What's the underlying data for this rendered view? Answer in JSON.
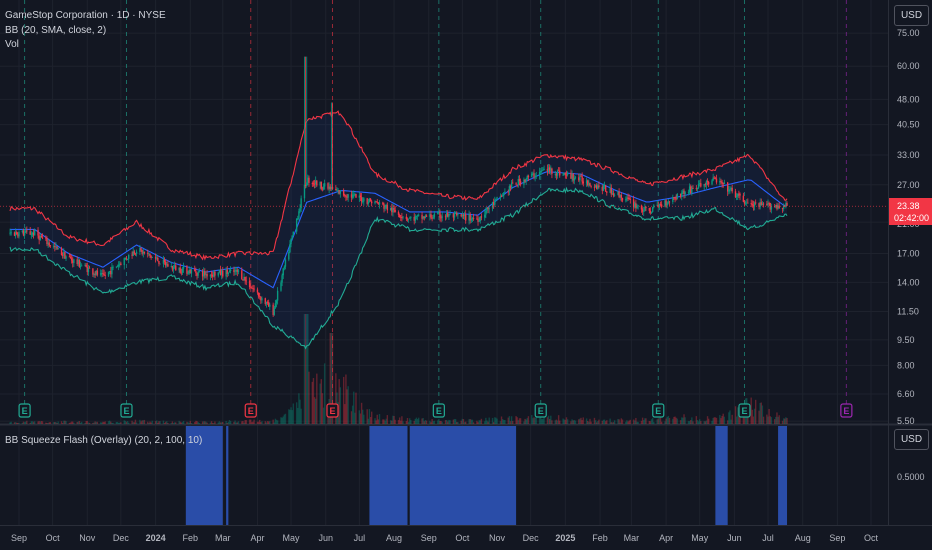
{
  "legend": {
    "symbol": "GameStop Corporation · 1D · NYSE",
    "bb": "BB (20, SMA, close, 2)",
    "vol": "Vol",
    "squeeze": "BB Squeeze Flash (Overlay) (20, 2, 100, 10)"
  },
  "currency_button": "USD",
  "colors": {
    "background": "#131722",
    "upper_band": "#f23645",
    "lower_band": "#22ab94",
    "basis": "#2962ff",
    "candle_up": "#089981",
    "candle_down": "#f23645",
    "squeeze": "#2a4da8",
    "earnings_past_up": "#22ab94",
    "earnings_past_down": "#f23645",
    "earnings_future": "#9c27b0"
  },
  "price_label": {
    "value": "23.38",
    "countdown": "02:42:00"
  },
  "chart_data": [
    {
      "type": "candlestick",
      "scale": "log",
      "y_ticks": [
        "75.00",
        "60.00",
        "48.00",
        "40.50",
        "33.00",
        "27.00",
        "21.00",
        "17.00",
        "14.00",
        "11.50",
        "9.50",
        "8.00",
        "6.60",
        "5.50"
      ],
      "ylim": [
        5.5,
        80
      ],
      "x_ticks": [
        "Sep",
        "Oct",
        "Nov",
        "Dec",
        "2024",
        "Feb",
        "Mar",
        "Apr",
        "May",
        "Jun",
        "Jul",
        "Aug",
        "Sep",
        "Oct",
        "Nov",
        "Dec",
        "2025",
        "Feb",
        "Mar",
        "Apr",
        "May",
        "Jun",
        "Jul",
        "Aug",
        "Sep",
        "Oct"
      ],
      "series": [
        {
          "name": "Close",
          "x": [
            "2023-09",
            "2023-10",
            "2023-11",
            "2023-12",
            "2024-01",
            "2024-02",
            "2024-03",
            "2024-04",
            "2024-05",
            "2024-06",
            "2024-07",
            "2024-08",
            "2024-09",
            "2024-10",
            "2024-11",
            "2024-12",
            "2025-01",
            "2025-02",
            "2025-03",
            "2025-04",
            "2025-05",
            "2025-06",
            "2025-07"
          ],
          "values": [
            19.5,
            16.5,
            14.5,
            17.5,
            15.5,
            14.8,
            15.0,
            11.5,
            28.0,
            25.5,
            24.0,
            21.5,
            22.0,
            21.5,
            27.0,
            30.0,
            28.0,
            25.5,
            22.5,
            25.5,
            28.0,
            23.5,
            23.38
          ]
        },
        {
          "name": "BB Upper",
          "x": [
            "2023-09",
            "2023-10",
            "2023-11",
            "2023-12",
            "2024-01",
            "2024-02",
            "2024-03",
            "2024-04",
            "2024-05",
            "2024-06",
            "2024-07",
            "2024-08",
            "2024-09",
            "2024-10",
            "2024-11",
            "2024-12",
            "2025-01",
            "2025-02",
            "2025-03",
            "2025-04",
            "2025-05",
            "2025-06",
            "2025-07"
          ],
          "values": [
            23.0,
            19.0,
            18.0,
            21.0,
            17.5,
            16.5,
            17.0,
            17.0,
            42.0,
            44.0,
            29.0,
            26.0,
            25.0,
            24.5,
            30.0,
            33.0,
            32.0,
            29.5,
            27.0,
            28.5,
            30.0,
            33.0,
            24.5
          ]
        },
        {
          "name": "BB Basis",
          "x": [
            "2023-09",
            "2023-10",
            "2023-11",
            "2023-12",
            "2024-01",
            "2024-02",
            "2024-03",
            "2024-04",
            "2024-05",
            "2024-06",
            "2024-07",
            "2024-08",
            "2024-09",
            "2024-10",
            "2024-11",
            "2024-12",
            "2025-01",
            "2025-02",
            "2025-03",
            "2025-04",
            "2025-05",
            "2025-06",
            "2025-07"
          ],
          "values": [
            20.0,
            17.0,
            15.5,
            18.0,
            16.0,
            15.0,
            15.5,
            13.5,
            24.0,
            26.0,
            25.5,
            22.5,
            22.5,
            22.0,
            26.5,
            29.5,
            29.0,
            26.0,
            24.0,
            25.0,
            26.5,
            28.0,
            23.5
          ]
        },
        {
          "name": "BB Lower",
          "x": [
            "2023-09",
            "2023-10",
            "2023-11",
            "2023-12",
            "2024-01",
            "2024-02",
            "2024-03",
            "2024-04",
            "2024-05",
            "2024-06",
            "2024-07",
            "2024-08",
            "2024-09",
            "2024-10",
            "2024-11",
            "2024-12",
            "2025-01",
            "2025-02",
            "2025-03",
            "2025-04",
            "2025-05",
            "2025-06",
            "2025-07"
          ],
          "values": [
            17.5,
            15.0,
            13.0,
            14.0,
            14.5,
            13.5,
            14.0,
            10.5,
            9.0,
            12.5,
            21.5,
            20.0,
            20.0,
            20.0,
            22.0,
            26.0,
            26.0,
            23.0,
            21.5,
            21.5,
            23.0,
            20.0,
            22.0
          ]
        },
        {
          "name": "Volume (M)",
          "x": [
            "2023-09",
            "2023-10",
            "2023-11",
            "2023-12",
            "2024-01",
            "2024-02",
            "2024-03",
            "2024-04",
            "2024-05",
            "2024-06",
            "2024-07",
            "2024-08",
            "2024-09",
            "2024-10",
            "2024-11",
            "2024-12",
            "2025-01",
            "2025-02",
            "2025-03",
            "2025-04",
            "2025-05",
            "2025-06",
            "2025-07"
          ],
          "values": [
            3,
            3,
            3,
            4,
            3,
            3,
            4,
            4,
            60,
            55,
            12,
            6,
            5,
            5,
            8,
            10,
            6,
            5,
            6,
            9,
            7,
            30,
            8
          ]
        }
      ],
      "earnings": [
        {
          "date": "2023-09-06",
          "result": "beat"
        },
        {
          "date": "2023-12-06",
          "result": "beat"
        },
        {
          "date": "2024-03-26",
          "result": "miss"
        },
        {
          "date": "2024-06-07",
          "result": "miss"
        },
        {
          "date": "2024-09-10",
          "result": "beat"
        },
        {
          "date": "2024-12-10",
          "result": "beat"
        },
        {
          "date": "2025-03-25",
          "result": "beat"
        },
        {
          "date": "2025-06-10",
          "result": "beat"
        },
        {
          "date": "2025-09-09",
          "result": "upcoming"
        }
      ]
    },
    {
      "type": "bar",
      "series_name": "BB Squeeze Flash",
      "y_ticks": [
        "0.5000"
      ],
      "squeeze_periods": [
        [
          "2024-01-28",
          "2024-03-01"
        ],
        [
          "2024-03-04",
          "2024-03-06"
        ],
        [
          "2024-07-10",
          "2024-08-13"
        ],
        [
          "2024-08-15",
          "2024-11-18"
        ],
        [
          "2025-05-15",
          "2025-05-26"
        ],
        [
          "2025-07-10",
          "2025-07-18"
        ]
      ]
    }
  ]
}
